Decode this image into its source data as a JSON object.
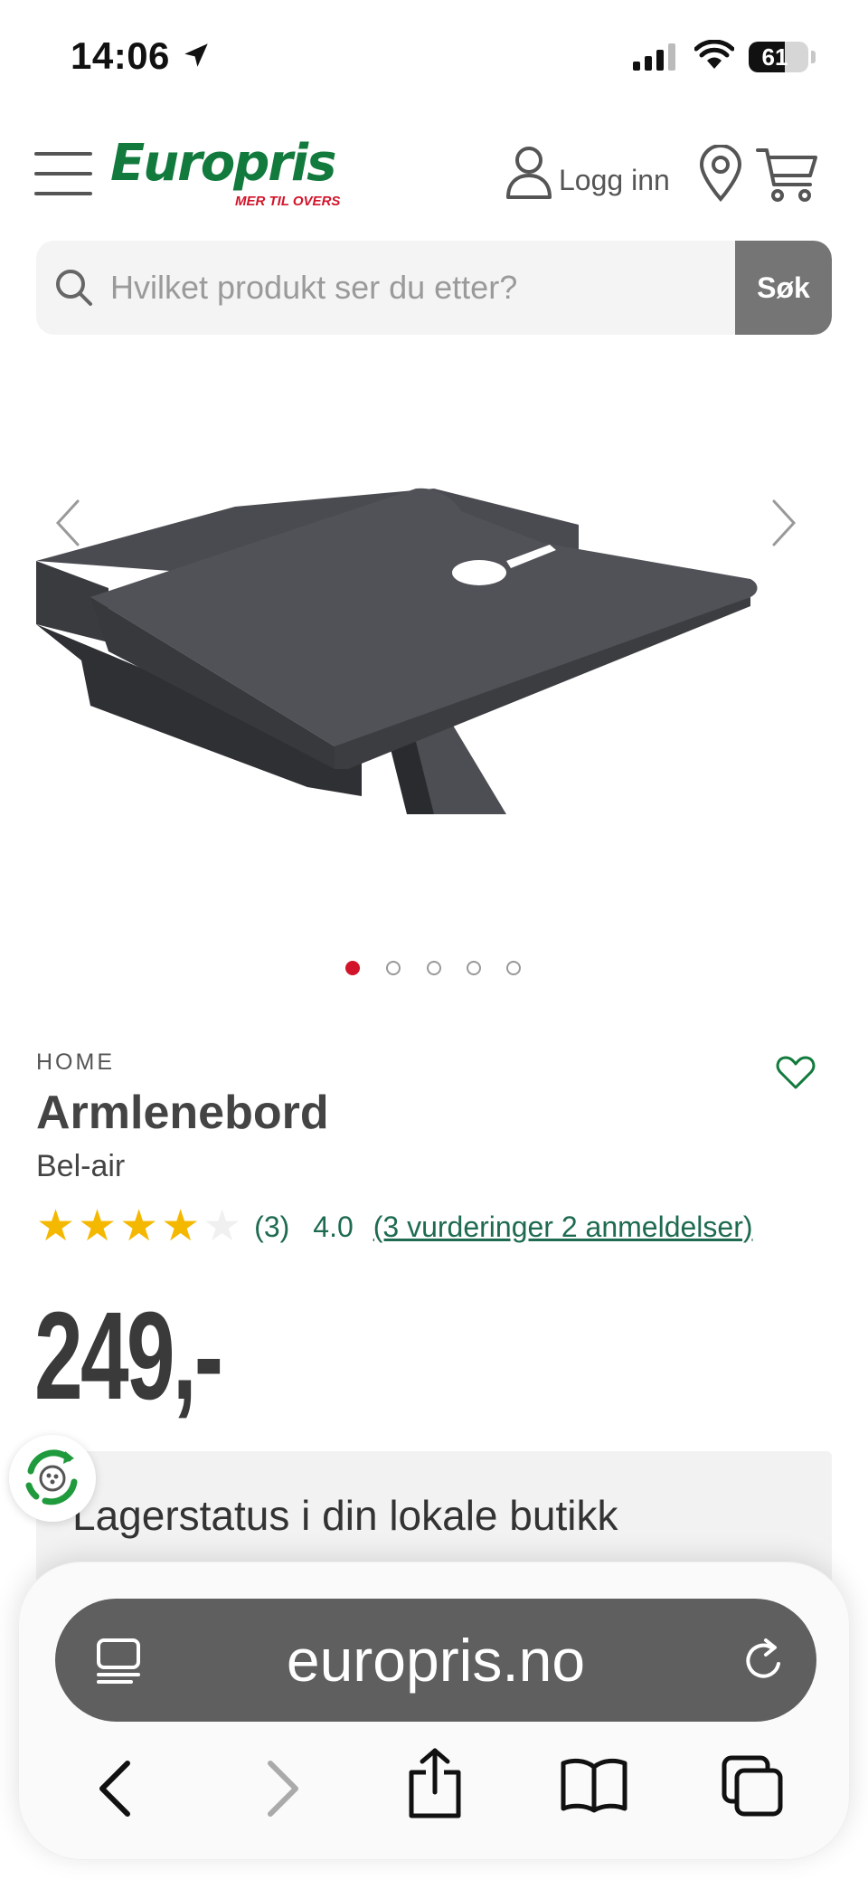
{
  "status_bar": {
    "time": "14:06",
    "battery_level": "61",
    "battery_fraction": 0.61
  },
  "header": {
    "logo_text": "Europris",
    "logo_tagline": "MER TIL OVERS",
    "login_label": "Logg inn",
    "brand_green": "#117a3c",
    "brand_red": "#d2142a"
  },
  "search": {
    "placeholder": "Hvilket produkt ser du etter?",
    "value": "",
    "button_label": "Søk"
  },
  "gallery": {
    "image_count": 5,
    "active_index": 0
  },
  "product": {
    "breadcrumb": "HOME",
    "title": "Armlenebord",
    "brand": "Bel-air",
    "rating_count": "(3)",
    "rating_score": "4.0",
    "rating_value": 4.0,
    "reviews_link": "(3 vurderinger 2 anmeldelser)",
    "price": "249,-",
    "star_color": "#f5b800"
  },
  "stock": {
    "title": "Lagerstatus i din lokale butikk"
  },
  "browser": {
    "url": "europris.no"
  },
  "icons": {
    "menu": "hamburger-icon",
    "user": "user-icon",
    "pin": "location-pin-icon",
    "cart": "cart-icon",
    "search": "search-icon",
    "heart": "heart-icon"
  }
}
